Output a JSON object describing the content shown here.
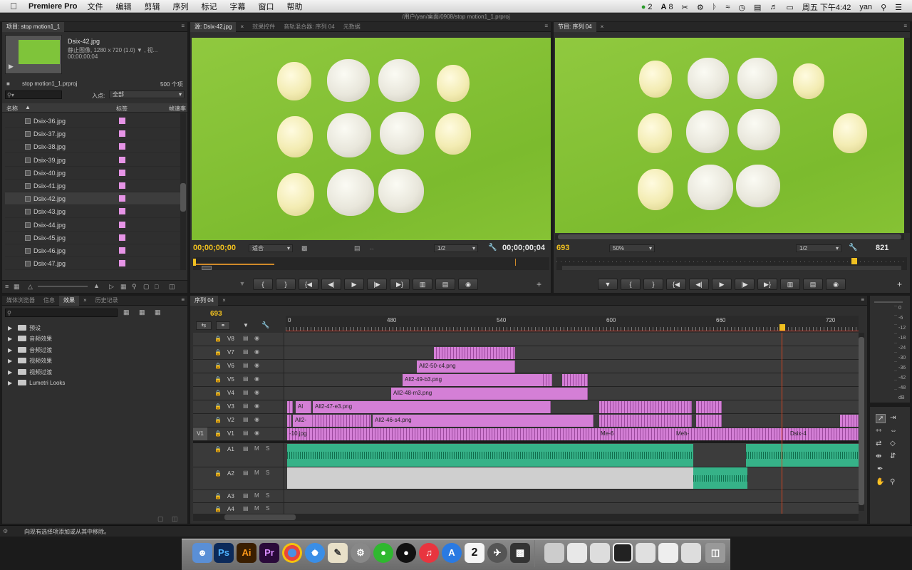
{
  "menubar": {
    "app": "Premiere Pro",
    "items": [
      "文件",
      "编辑",
      "剪辑",
      "序列",
      "标记",
      "字幕",
      "窗口",
      "帮助"
    ],
    "status": {
      "wechat_badge": "2",
      "ai_badge": "8",
      "clock": "周五 下午4:42",
      "user": "yan"
    }
  },
  "window": {
    "path": "/用户/yan/桌面/0908/stop motion1_1.prproj"
  },
  "project": {
    "tab": "项目: stop motion1_1",
    "preview_name": "Dsix-42.jpg",
    "preview_info": "静止图像, 1280 x 720 (1.0) ▼ , 视...",
    "preview_tc": "00;00;00;04",
    "file": "stop motion1_1.prproj",
    "count": "500 个项",
    "inpoint_label": "入点:",
    "inpoint_value": "全部",
    "col_name": "名称",
    "col_label": "标签",
    "col_rate": "帧速率",
    "items": [
      "Dsix-36.jpg",
      "Dsix-37.jpg",
      "Dsix-38.jpg",
      "Dsix-39.jpg",
      "Dsix-40.jpg",
      "Dsix-41.jpg",
      "Dsix-42.jpg",
      "Dsix-43.jpg",
      "Dsix-44.jpg",
      "Dsix-45.jpg",
      "Dsix-46.jpg",
      "Dsix-47.jpg"
    ],
    "label_color": "#e694e6"
  },
  "source": {
    "tabs": [
      "源: Dsix-42.jpg",
      "效果控件",
      "音轨混合器: 序列 04",
      "元数据"
    ],
    "tc_left": "00;00;00;00",
    "fit": "适合",
    "quality": "1/2",
    "tc_right": "00;00;00;04"
  },
  "program": {
    "tab": "节目: 序列 04",
    "tc_left": "693",
    "zoom": "50%",
    "quality": "1/2",
    "tc_right": "821"
  },
  "effects": {
    "tabs": [
      "媒体浏览器",
      "信息",
      "效果",
      "历史记录"
    ],
    "items": [
      "预设",
      "音频效果",
      "音频过渡",
      "视频效果",
      "视频过渡",
      "Lumetri Looks"
    ]
  },
  "timeline": {
    "tab": "序列 04",
    "tc": "693",
    "ruler": [
      "0",
      "480",
      "540",
      "600",
      "660",
      "720"
    ],
    "video_tracks": [
      "V8",
      "V7",
      "V6",
      "V5",
      "V4",
      "V3",
      "V2",
      "V1"
    ],
    "audio_tracks": [
      "A1",
      "A2",
      "A3",
      "A4"
    ],
    "v1_source_label": "V1",
    "track_m": "M",
    "track_s": "S",
    "clips": {
      "v6": "All2-50-c4.png",
      "v5": "All2-49-b3.png",
      "v4": "All2-48-m3.png",
      "v3a": "Al",
      "v3b": "All2-47-e3.png",
      "v2a": "All2-",
      "v2b": "All2-46-s4.png",
      "v1a": "-10.jpg",
      "v1b": "Me-6",
      "v1c": "Meh-",
      "v1d": "Dsix-4"
    }
  },
  "meter": {
    "labels": [
      "0",
      "-6",
      "-12",
      "-18",
      "-24",
      "-30",
      "-36",
      "-42",
      "-48",
      "dB"
    ]
  },
  "status_bar": "向现有选择项添加或从其中移除。",
  "dock": {
    "ps": "Ps",
    "ai": "Ai",
    "pr": "Pr",
    "cal": "2"
  }
}
